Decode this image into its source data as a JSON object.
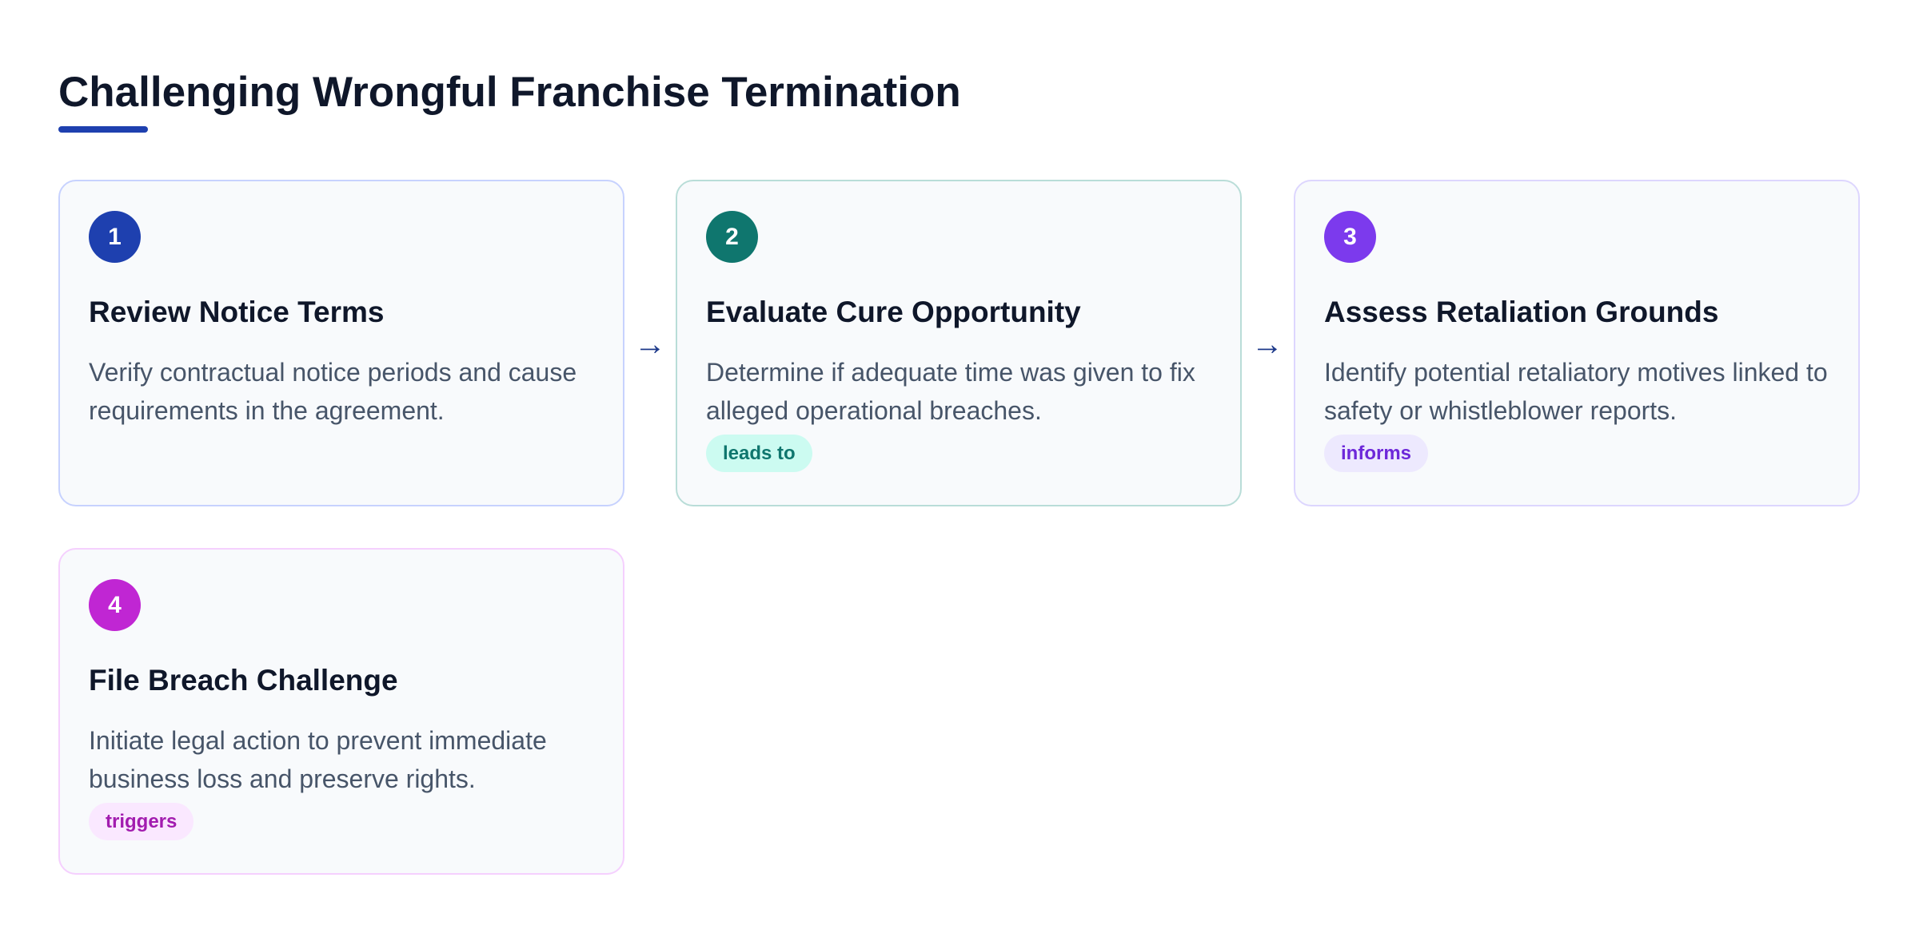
{
  "title": "Challenging Wrongful Franchise Termination",
  "colors": {
    "accent": "#1e40af",
    "step1": "#1e40af",
    "step2": "#0f766e",
    "step3": "#7c3aed",
    "step4": "#c026d3"
  },
  "steps": [
    {
      "number": "1",
      "title": "Review Notice Terms",
      "description": "Verify contractual notice periods and cause requirements in the agreement.",
      "tag": ""
    },
    {
      "number": "2",
      "title": "Evaluate Cure Opportunity",
      "description": "Determine if adequate time was given to fix alleged operational breaches.",
      "tag": "leads to"
    },
    {
      "number": "3",
      "title": "Assess Retaliation Grounds",
      "description": "Identify potential retaliatory motives linked to safety or whistleblower reports.",
      "tag": "informs"
    },
    {
      "number": "4",
      "title": "File Breach Challenge",
      "description": "Initiate legal action to prevent immediate business loss and preserve rights.",
      "tag": "triggers"
    }
  ],
  "connectors": [
    "→",
    "→"
  ]
}
